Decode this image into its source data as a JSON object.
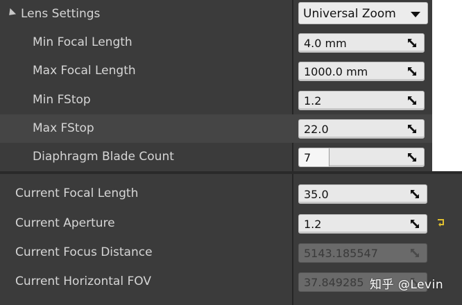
{
  "header": {
    "label": "Lens Settings",
    "preset_value": "Universal Zoom"
  },
  "lens_settings": [
    {
      "label": "Min Focal Length",
      "value": "4.0 mm"
    },
    {
      "label": "Max Focal Length",
      "value": "1000.0 mm"
    },
    {
      "label": "Min FStop",
      "value": "1.2"
    },
    {
      "label": "Max FStop",
      "value": "22.0"
    },
    {
      "label": "Diaphragm Blade Count",
      "value": "7"
    }
  ],
  "current_settings": [
    {
      "label": "Current Focal Length",
      "value": "35.0"
    },
    {
      "label": "Current Aperture",
      "value": "1.2"
    },
    {
      "label": "Current Focus Distance",
      "value": "5143.185547"
    },
    {
      "label": "Current Horizontal FOV",
      "value": "37.849285"
    }
  ],
  "icons": {
    "expand": "triangle-collapse-icon",
    "drag": "drag-arrows-icon",
    "reset": "reset-to-default-icon"
  },
  "colors": {
    "panel_bg": "#3b3b3b",
    "highlight_row": "#454545",
    "field_bg": "#e8e8e8",
    "reset_icon": "#e0c030"
  },
  "watermark": "知乎 @Levin"
}
